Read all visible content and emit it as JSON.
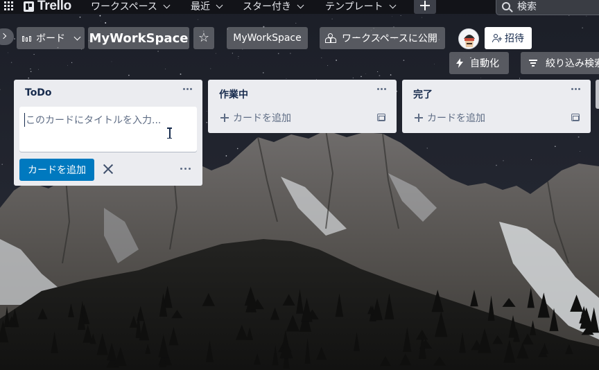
{
  "topnav": {
    "apps_icon": "apps-grid-icon",
    "brand": "Trello",
    "menus": [
      {
        "label": "ワークスペース"
      },
      {
        "label": "最近"
      },
      {
        "label": "スター付き"
      },
      {
        "label": "テンプレート"
      }
    ],
    "create_icon": "plus-icon",
    "search_placeholder": "検索"
  },
  "board_header": {
    "view_switcher_label": "ボード",
    "board_name": "MyWorkSpace",
    "star_icon": "☆",
    "workspace_label": "MyWorkSpace",
    "visibility_label": "ワークスペースに公開",
    "invite_label": "招待",
    "automation_label": "自動化",
    "filter_label": "絞り込み検索"
  },
  "lists": [
    {
      "title": "ToDo",
      "composer": {
        "placeholder": "このカードにタイトルを入力...",
        "add_button": "カードを追加"
      }
    },
    {
      "title": "作業中",
      "add_card": "カードを追加"
    },
    {
      "title": "完了",
      "add_card": "カードを追加"
    }
  ],
  "colors": {
    "nav_bg": "#121318",
    "list_bg": "#ebecf0",
    "primary_button": "#0079bf",
    "text_dark": "#172b4d",
    "text_muted": "#5e6c84"
  }
}
